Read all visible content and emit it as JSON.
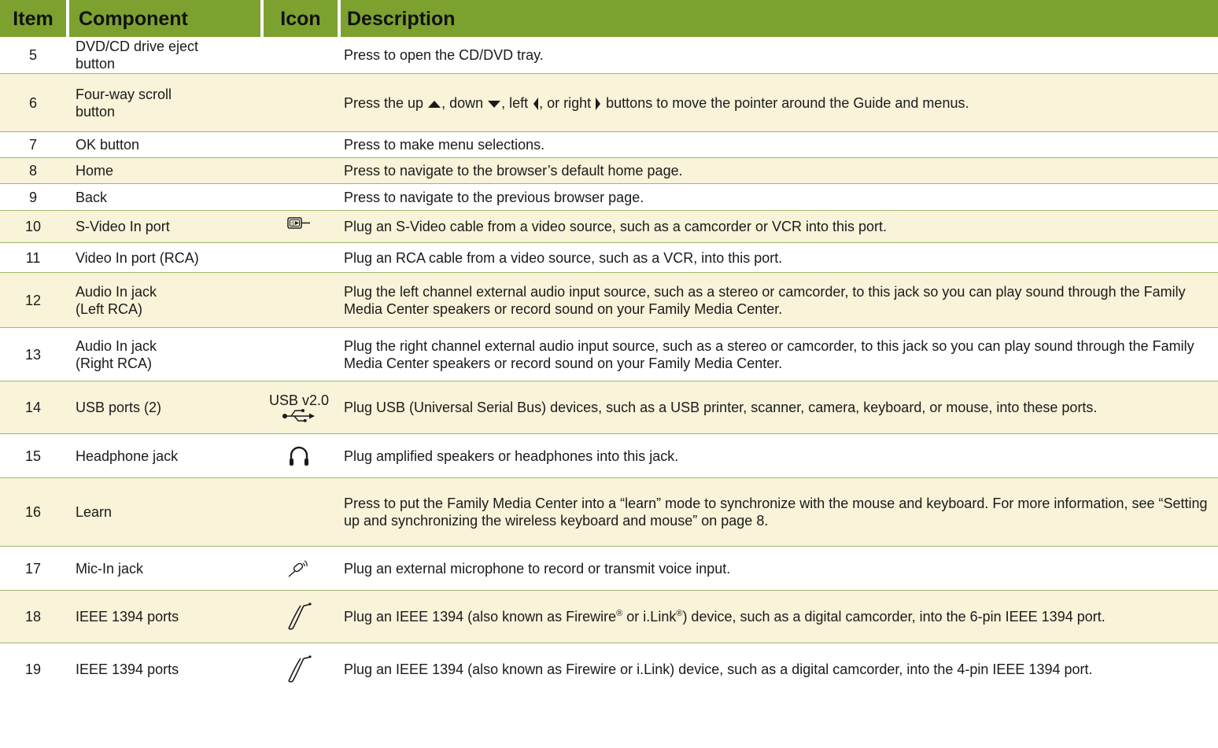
{
  "headers": {
    "item": "Item",
    "component": "Component",
    "icon": "Icon",
    "description": "Description"
  },
  "colors": {
    "header_bg": "#7da12f",
    "alt_row_bg": "#f8f3d9",
    "row_border": "#9fb868"
  },
  "rows": [
    {
      "item": "5",
      "component": "DVD/CD drive eject button",
      "icon": "",
      "description": "Press to open the CD/DVD tray."
    },
    {
      "item": "6",
      "component": "Four-way scroll button",
      "icon": "",
      "description_parts": [
        "Press the up ",
        ", down ",
        ", left ",
        ", or right ",
        " buttons to move the pointer around the Guide and menus."
      ],
      "description_icons": [
        "up-triangle-icon",
        "down-triangle-icon",
        "left-triangle-icon",
        "right-triangle-icon"
      ]
    },
    {
      "item": "7",
      "component": "OK button",
      "icon": "",
      "description": "Press to make menu selections."
    },
    {
      "item": "8",
      "component": "Home",
      "icon": "",
      "description": "Press to navigate to the browser’s default home page."
    },
    {
      "item": "9",
      "component": "Back",
      "icon": "",
      "description": "Press to navigate to the previous browser page."
    },
    {
      "item": "10",
      "component": "S-Video In port",
      "icon": "s-video-icon",
      "description": "Plug an S-Video cable from a video source, such as a camcorder or VCR into this port."
    },
    {
      "item": "11",
      "component": "Video In port (RCA)",
      "icon": "",
      "description": "Plug an RCA cable from a video source, such as a VCR, into this port."
    },
    {
      "item": "12",
      "component_lines": [
        "Audio In jack",
        "(Left RCA)"
      ],
      "icon": "",
      "description": "Plug the left channel external audio input source, such as a stereo or camcorder, to this jack so you can play sound through the Family Media Center speakers or record sound on your Family Media Center."
    },
    {
      "item": "13",
      "component_lines": [
        "Audio In jack",
        "(Right RCA)"
      ],
      "icon": "",
      "description": "Plug the right channel external audio input source, such as a stereo or camcorder, to this jack so you can play sound through the Family Media Center speakers or record sound on your Family Media Center."
    },
    {
      "item": "14",
      "component": "USB ports (2)",
      "icon": "usb-icon",
      "icon_label": "USB v2.0",
      "description": "Plug USB (Universal Serial Bus) devices, such as a USB printer, scanner, camera, keyboard, or mouse, into these ports."
    },
    {
      "item": "15",
      "component": "Headphone jack",
      "icon": "headphone-icon",
      "description": "Plug amplified speakers or headphones into this jack."
    },
    {
      "item": "16",
      "component": "Learn",
      "icon": "",
      "description": "Press to put the Family Media Center into a “learn” mode to synchronize with the mouse and keyboard. For more information, see “Setting up and synchronizing the wireless keyboard and mouse” on page 8."
    },
    {
      "item": "17",
      "component": "Mic-In jack",
      "icon": "microphone-icon",
      "description": "Plug an external microphone to record or transmit voice input."
    },
    {
      "item": "18",
      "component": "IEEE 1394 ports",
      "icon": "firewire-icon",
      "description_parts": [
        "Plug an IEEE 1394 (also known as Firewire",
        "®",
        " or i.Link",
        "®",
        ") device, such as a digital camcorder, into the 6-pin IEEE 1394 port."
      ]
    },
    {
      "item": "19",
      "component": "IEEE 1394 ports",
      "icon": "firewire-icon",
      "description": "Plug an IEEE 1394 (also known as Firewire or i.Link) device, such as a digital camcorder, into the 4-pin IEEE 1394 port."
    }
  ]
}
